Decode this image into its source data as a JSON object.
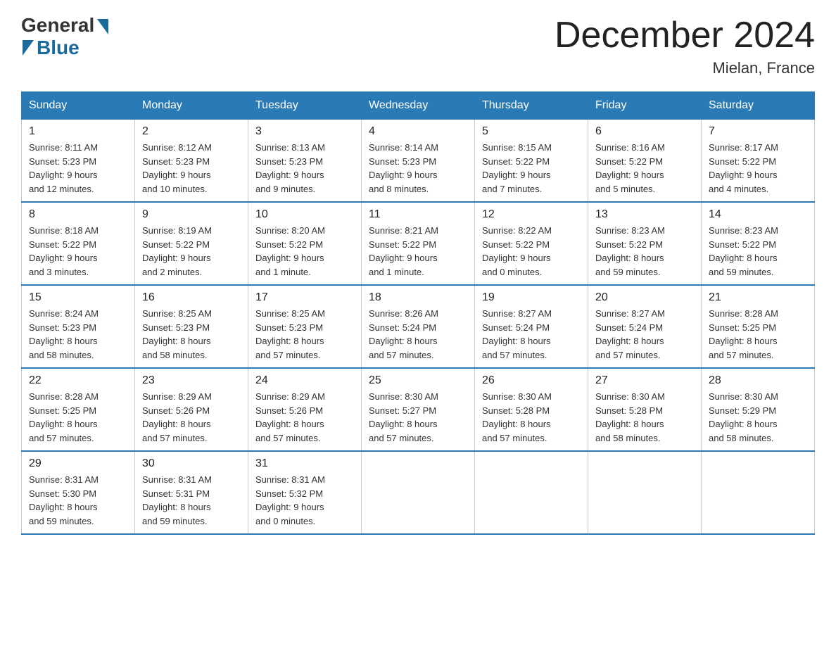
{
  "header": {
    "logo_general": "General",
    "logo_blue": "Blue",
    "month_title": "December 2024",
    "location": "Mielan, France"
  },
  "days_of_week": [
    "Sunday",
    "Monday",
    "Tuesday",
    "Wednesday",
    "Thursday",
    "Friday",
    "Saturday"
  ],
  "weeks": [
    [
      {
        "day": "1",
        "sunrise": "8:11 AM",
        "sunset": "5:23 PM",
        "daylight": "9 hours and 12 minutes."
      },
      {
        "day": "2",
        "sunrise": "8:12 AM",
        "sunset": "5:23 PM",
        "daylight": "9 hours and 10 minutes."
      },
      {
        "day": "3",
        "sunrise": "8:13 AM",
        "sunset": "5:23 PM",
        "daylight": "9 hours and 9 minutes."
      },
      {
        "day": "4",
        "sunrise": "8:14 AM",
        "sunset": "5:23 PM",
        "daylight": "9 hours and 8 minutes."
      },
      {
        "day": "5",
        "sunrise": "8:15 AM",
        "sunset": "5:22 PM",
        "daylight": "9 hours and 7 minutes."
      },
      {
        "day": "6",
        "sunrise": "8:16 AM",
        "sunset": "5:22 PM",
        "daylight": "9 hours and 5 minutes."
      },
      {
        "day": "7",
        "sunrise": "8:17 AM",
        "sunset": "5:22 PM",
        "daylight": "9 hours and 4 minutes."
      }
    ],
    [
      {
        "day": "8",
        "sunrise": "8:18 AM",
        "sunset": "5:22 PM",
        "daylight": "9 hours and 3 minutes."
      },
      {
        "day": "9",
        "sunrise": "8:19 AM",
        "sunset": "5:22 PM",
        "daylight": "9 hours and 2 minutes."
      },
      {
        "day": "10",
        "sunrise": "8:20 AM",
        "sunset": "5:22 PM",
        "daylight": "9 hours and 1 minute."
      },
      {
        "day": "11",
        "sunrise": "8:21 AM",
        "sunset": "5:22 PM",
        "daylight": "9 hours and 1 minute."
      },
      {
        "day": "12",
        "sunrise": "8:22 AM",
        "sunset": "5:22 PM",
        "daylight": "9 hours and 0 minutes."
      },
      {
        "day": "13",
        "sunrise": "8:23 AM",
        "sunset": "5:22 PM",
        "daylight": "8 hours and 59 minutes."
      },
      {
        "day": "14",
        "sunrise": "8:23 AM",
        "sunset": "5:22 PM",
        "daylight": "8 hours and 59 minutes."
      }
    ],
    [
      {
        "day": "15",
        "sunrise": "8:24 AM",
        "sunset": "5:23 PM",
        "daylight": "8 hours and 58 minutes."
      },
      {
        "day": "16",
        "sunrise": "8:25 AM",
        "sunset": "5:23 PM",
        "daylight": "8 hours and 58 minutes."
      },
      {
        "day": "17",
        "sunrise": "8:25 AM",
        "sunset": "5:23 PM",
        "daylight": "8 hours and 57 minutes."
      },
      {
        "day": "18",
        "sunrise": "8:26 AM",
        "sunset": "5:24 PM",
        "daylight": "8 hours and 57 minutes."
      },
      {
        "day": "19",
        "sunrise": "8:27 AM",
        "sunset": "5:24 PM",
        "daylight": "8 hours and 57 minutes."
      },
      {
        "day": "20",
        "sunrise": "8:27 AM",
        "sunset": "5:24 PM",
        "daylight": "8 hours and 57 minutes."
      },
      {
        "day": "21",
        "sunrise": "8:28 AM",
        "sunset": "5:25 PM",
        "daylight": "8 hours and 57 minutes."
      }
    ],
    [
      {
        "day": "22",
        "sunrise": "8:28 AM",
        "sunset": "5:25 PM",
        "daylight": "8 hours and 57 minutes."
      },
      {
        "day": "23",
        "sunrise": "8:29 AM",
        "sunset": "5:26 PM",
        "daylight": "8 hours and 57 minutes."
      },
      {
        "day": "24",
        "sunrise": "8:29 AM",
        "sunset": "5:26 PM",
        "daylight": "8 hours and 57 minutes."
      },
      {
        "day": "25",
        "sunrise": "8:30 AM",
        "sunset": "5:27 PM",
        "daylight": "8 hours and 57 minutes."
      },
      {
        "day": "26",
        "sunrise": "8:30 AM",
        "sunset": "5:28 PM",
        "daylight": "8 hours and 57 minutes."
      },
      {
        "day": "27",
        "sunrise": "8:30 AM",
        "sunset": "5:28 PM",
        "daylight": "8 hours and 58 minutes."
      },
      {
        "day": "28",
        "sunrise": "8:30 AM",
        "sunset": "5:29 PM",
        "daylight": "8 hours and 58 minutes."
      }
    ],
    [
      {
        "day": "29",
        "sunrise": "8:31 AM",
        "sunset": "5:30 PM",
        "daylight": "8 hours and 59 minutes."
      },
      {
        "day": "30",
        "sunrise": "8:31 AM",
        "sunset": "5:31 PM",
        "daylight": "8 hours and 59 minutes."
      },
      {
        "day": "31",
        "sunrise": "8:31 AM",
        "sunset": "5:32 PM",
        "daylight": "9 hours and 0 minutes."
      },
      null,
      null,
      null,
      null
    ]
  ],
  "labels": {
    "sunrise": "Sunrise:",
    "sunset": "Sunset:",
    "daylight": "Daylight:"
  }
}
